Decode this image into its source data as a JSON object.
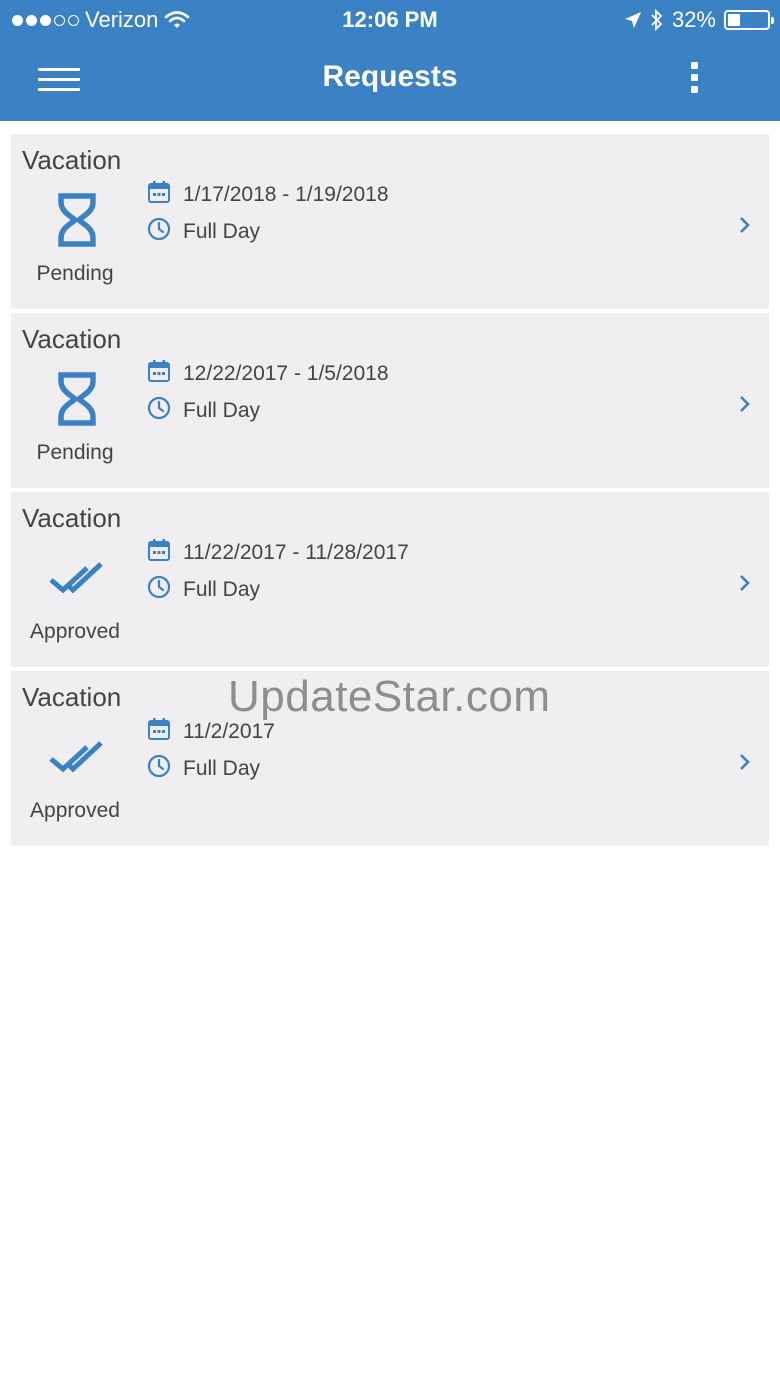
{
  "status_bar": {
    "carrier": "Verizon",
    "time": "12:06 PM",
    "battery": "32%",
    "battery_level": 0.32,
    "signal_filled": 3,
    "signal_total": 5
  },
  "header": {
    "title": "Requests"
  },
  "requests": [
    {
      "type": "Vacation",
      "status": "Pending",
      "status_icon": "hourglass-icon",
      "dates": "1/17/2018 - 1/19/2018",
      "duration": "Full Day"
    },
    {
      "type": "Vacation",
      "status": "Pending",
      "status_icon": "hourglass-icon",
      "dates": "12/22/2017 - 1/5/2018",
      "duration": "Full Day"
    },
    {
      "type": "Vacation",
      "status": "Approved",
      "status_icon": "double-check-icon",
      "dates": "11/22/2017 - 11/28/2017",
      "duration": "Full Day"
    },
    {
      "type": "Vacation",
      "status": "Approved",
      "status_icon": "double-check-icon",
      "dates": "11/2/2017",
      "duration": "Full Day"
    }
  ],
  "watermark": "UpdateStar.com",
  "colors": {
    "brand": "#3a82c4",
    "card_bg": "#f0eef0",
    "icon": "#3a82c4"
  }
}
